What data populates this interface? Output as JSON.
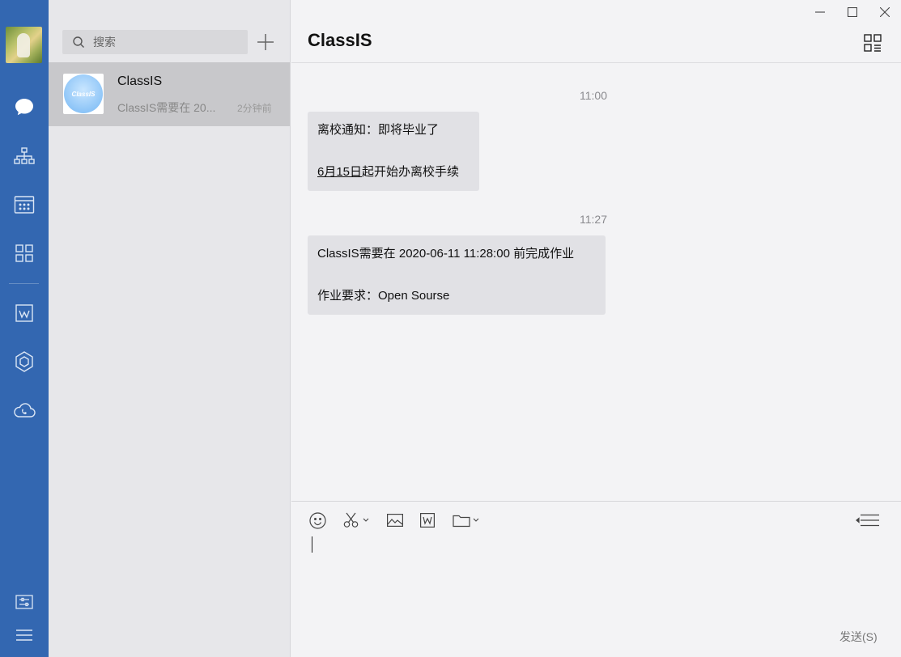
{
  "sidebar": {
    "icons": [
      "avatar",
      "chat-icon",
      "contacts-icon",
      "calendar-icon",
      "apps-icon",
      "document-icon",
      "workbench-icon",
      "cloud-phone-icon",
      "settings-icon",
      "menu-icon"
    ]
  },
  "conversation_list": {
    "search_placeholder": "搜索",
    "items": [
      {
        "name": "ClassIS",
        "preview": "ClassIS需要在 20...",
        "time": "2分钟前",
        "avatar_text": "ClassIS"
      }
    ]
  },
  "chat": {
    "title": "ClassIS",
    "messages": [
      {
        "timestamp": "11:00",
        "line1": "离校通知：即将毕业了",
        "line2_link": "6月15日",
        "line2_rest": "起开始办离校手续"
      },
      {
        "timestamp": "11:27",
        "line1": "ClassIS需要在 2020-06-11 11:28:00 前完成作业",
        "line2": "作业要求：Open Sourse"
      }
    ]
  },
  "composer": {
    "send_label": "发送(S)",
    "tools": [
      "emoji-icon",
      "screenshot-icon",
      "image-icon",
      "word-doc-icon",
      "folder-icon",
      "history-icon"
    ]
  },
  "colors": {
    "rail": "#3367b1",
    "list_bg": "#e7e7ea",
    "selected": "#c8c8cb",
    "chat_bg": "#f3f3f5",
    "bubble": "#e1e1e5"
  }
}
